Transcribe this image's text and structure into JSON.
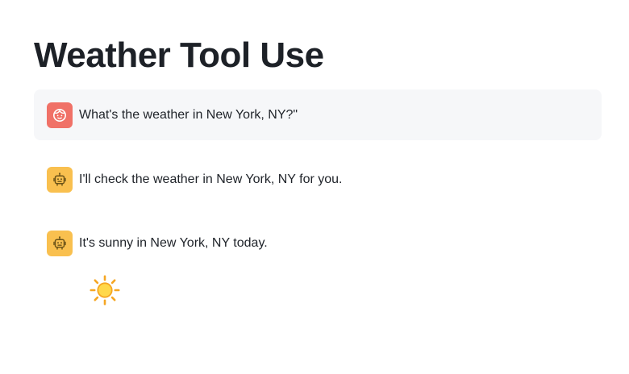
{
  "page": {
    "title": "Weather Tool Use"
  },
  "messages": [
    {
      "role": "user",
      "avatar_icon": "user-face-icon",
      "text": "What's the weather in New York, NY?\""
    },
    {
      "role": "assistant",
      "avatar_icon": "robot-icon",
      "text": "I'll check the weather in New York, NY for you."
    },
    {
      "role": "assistant",
      "avatar_icon": "robot-icon",
      "text": "It's sunny in New York, NY today."
    }
  ],
  "weather_widget": {
    "icon": "sun-icon"
  },
  "colors": {
    "user_avatar": "#f07167",
    "bot_avatar": "#f9c04f",
    "user_message_bg": "#f6f7f9",
    "sun_core": "#ffd84a",
    "sun_rays": "#f5a623"
  }
}
